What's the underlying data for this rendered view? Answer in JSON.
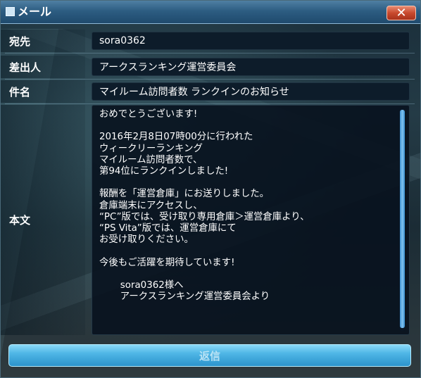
{
  "window": {
    "title": "メール"
  },
  "fields": {
    "to": {
      "label": "宛先",
      "value": "sora0362"
    },
    "from": {
      "label": "差出人",
      "value": "アークスランキング運営委員会"
    },
    "subject": {
      "label": "件名",
      "value": "マイルーム訪問者数 ランクインのお知らせ"
    },
    "body": {
      "label": "本文",
      "text": "おめでとうございます!\n\n2016年2月8日07時00分に行われた\nウィークリーランキング\nマイルーム訪問者数で、\n第94位にランクインしました!\n\n報酬を「運営倉庫」にお送りしました。\n倉庫端末にアクセスし、\n“PC”版では、受け取り専用倉庫＞運営倉庫より、\n“PS Vita”版では、運営倉庫にて\nお受け取りください。\n\n今後もご活躍を期待しています!\n\n       sora0362様へ\n       アークスランキング運営委員会より"
    }
  },
  "buttons": {
    "reply": "返信"
  },
  "icons": {
    "window": "mail-icon",
    "close": "close-icon"
  },
  "colors": {
    "accent": "#4fb6e6",
    "close": "#c8492e"
  }
}
